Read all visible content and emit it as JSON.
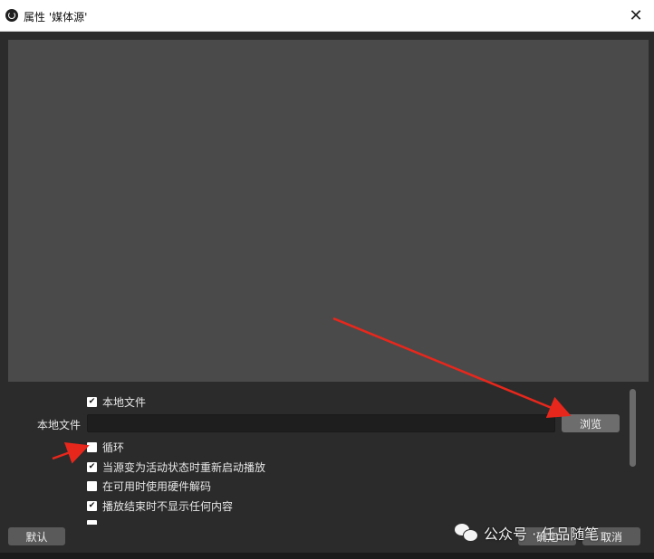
{
  "window": {
    "title": "属性 '媒体源'",
    "close_glyph": "✕"
  },
  "properties": {
    "local_file_checkbox": {
      "label": "本地文件",
      "checked": true
    },
    "file_field": {
      "label": "本地文件",
      "value": ""
    },
    "browse_label": "浏览",
    "options": [
      {
        "label": "循环",
        "checked": false
      },
      {
        "label": "当源变为活动状态时重新启动播放",
        "checked": true
      },
      {
        "label": "在可用时使用硬件解码",
        "checked": false
      },
      {
        "label": "播放结束时不显示任何内容",
        "checked": true
      }
    ]
  },
  "footer": {
    "default_label": "默认",
    "ok_label": "确定",
    "cancel_label": "取消"
  },
  "watermark": {
    "text": "公众号 · 任品随笔"
  },
  "colors": {
    "preview_bg": "#4a4a4a",
    "dialog_bg": "#2b2b2b",
    "annotation_arrow": "#e8271c"
  }
}
